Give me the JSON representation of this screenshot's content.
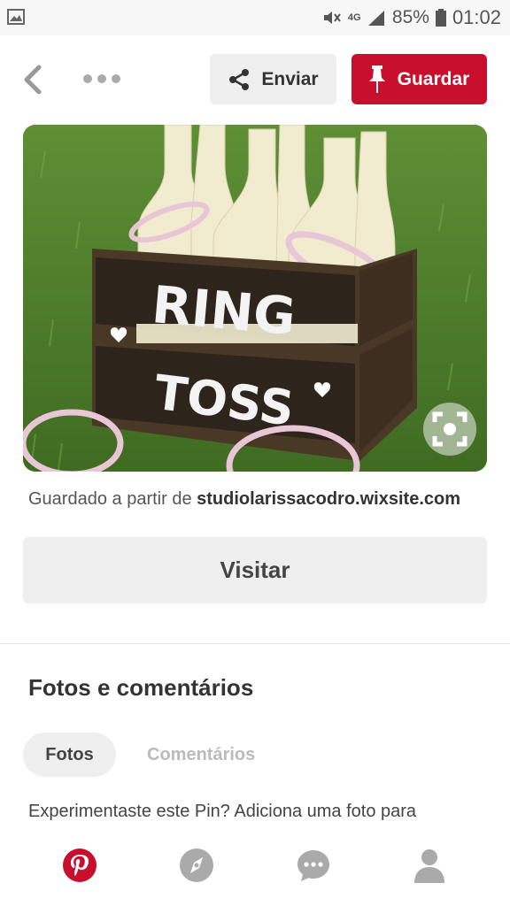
{
  "status_bar": {
    "battery": "85%",
    "time": "01:02",
    "network": "4G"
  },
  "toolbar": {
    "send_label": "Enviar",
    "save_label": "Guardar",
    "save_color": "#c8102e"
  },
  "pin": {
    "image_text_line1": "RING",
    "image_text_line2": "TOSS",
    "source_prefix": "Guardado a partir de",
    "source_domain": "studiolarissacodro.wixsite.com",
    "visit_label": "Visitar"
  },
  "photos_section": {
    "title": "Fotos e comentários",
    "tabs": [
      {
        "label": "Fotos",
        "active": true
      },
      {
        "label": "Comentários",
        "active": false
      }
    ],
    "prompt": "Experimentaste este Pin? Adiciona uma foto para"
  },
  "bottom_nav": {
    "items": [
      {
        "icon": "pinterest-home-icon",
        "active": true
      },
      {
        "icon": "explore-compass-icon",
        "active": false
      },
      {
        "icon": "messages-icon",
        "active": false
      },
      {
        "icon": "profile-icon",
        "active": false
      }
    ]
  }
}
